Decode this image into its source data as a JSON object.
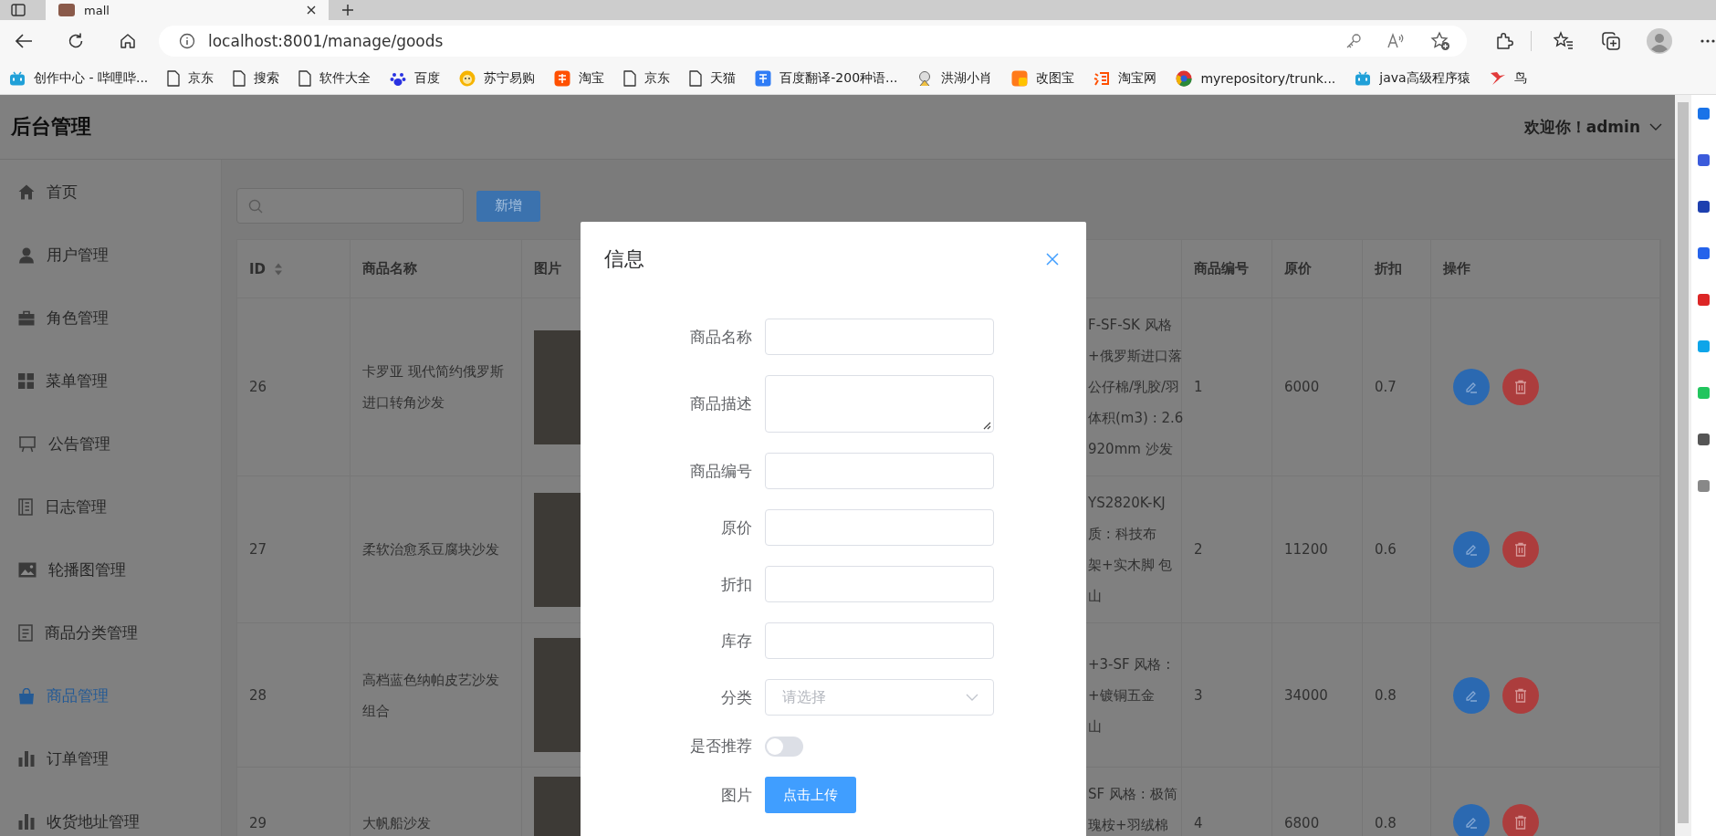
{
  "browser": {
    "tab_title": "mall",
    "url": "localhost:8001/manage/goods",
    "bookmarks": [
      {
        "label": "创作中心 - 哔哩哔...",
        "kind": "tv"
      },
      {
        "label": "京东",
        "kind": "page"
      },
      {
        "label": "搜索",
        "kind": "page"
      },
      {
        "label": "软件大全",
        "kind": "page"
      },
      {
        "label": "百度",
        "kind": "paw"
      },
      {
        "label": "苏宁易购",
        "kind": "lion"
      },
      {
        "label": "淘宝",
        "kind": "orange-square"
      },
      {
        "label": "京东",
        "kind": "page"
      },
      {
        "label": "天猫",
        "kind": "page"
      },
      {
        "label": "百度翻译-200种语...",
        "kind": "blue-square"
      },
      {
        "label": "洪湖小肖",
        "kind": "figure"
      },
      {
        "label": "改图宝",
        "kind": "yellow-square"
      },
      {
        "label": "淘宝网",
        "kind": "orange-mark"
      },
      {
        "label": "myrepository/trunk...",
        "kind": "circle"
      },
      {
        "label": "java高级程序猿",
        "kind": "tv"
      },
      {
        "label": "鸟",
        "kind": "bird"
      }
    ]
  },
  "app": {
    "title": "后台管理",
    "user": "欢迎你！admin"
  },
  "sidebar": {
    "items": [
      {
        "label": "首页",
        "kind": "home",
        "selected": false
      },
      {
        "label": "用户管理",
        "kind": "user",
        "selected": false
      },
      {
        "label": "角色管理",
        "kind": "briefcase",
        "selected": false
      },
      {
        "label": "菜单管理",
        "kind": "grid",
        "selected": false
      },
      {
        "label": "公告管理",
        "kind": "board",
        "selected": false
      },
      {
        "label": "日志管理",
        "kind": "notebook",
        "selected": false
      },
      {
        "label": "轮播图管理",
        "kind": "image",
        "selected": false
      },
      {
        "label": "商品分类管理",
        "kind": "document",
        "selected": false
      },
      {
        "label": "商品管理",
        "kind": "bag",
        "selected": true
      },
      {
        "label": "订单管理",
        "kind": "chart",
        "selected": false
      },
      {
        "label": "收货地址管理",
        "kind": "chart",
        "selected": false
      }
    ]
  },
  "toolbar": {
    "add_button": "新增"
  },
  "table": {
    "columns": [
      {
        "label": "ID",
        "sortable": true
      },
      {
        "label": "商品名称"
      },
      {
        "label": "图片"
      },
      {
        "label": "商品编号"
      },
      {
        "label": "原价"
      },
      {
        "label": "折扣"
      },
      {
        "label": "操作"
      }
    ],
    "rows": [
      {
        "id": "26",
        "name": "卡罗亚 现代简约俄罗斯进口转角沙发",
        "description": [
          "F-SF-SK 风格",
          "+俄罗斯进口落",
          "公仔棉/乳胶/羽",
          "体积(m3) : 2.6",
          "920mm 沙发"
        ],
        "code": "1",
        "price": "6000",
        "discount": "0.7"
      },
      {
        "id": "27",
        "name": "柔软治愈系豆腐块沙发",
        "description": [
          "YS2820K-KJ",
          "质 : 科技布",
          "架+实木脚 包",
          "山"
        ],
        "code": "2",
        "price": "11200",
        "discount": "0.6"
      },
      {
        "id": "28",
        "name": "高档蓝色纳帕皮艺沙发组合",
        "description": [
          "+3-SF 风格 :",
          "+镀铜五金",
          "山"
        ],
        "code": "3",
        "price": "34000",
        "discount": "0.8"
      },
      {
        "id": "29",
        "name": "大帆船沙发",
        "description": [
          "SF 风格 : 极简",
          "瑰桉+羽绒棉"
        ],
        "code": "4",
        "price": "6800",
        "discount": "0.8"
      }
    ]
  },
  "dialog": {
    "title": "信息",
    "fields": [
      {
        "label": "商品名称",
        "kind": "input"
      },
      {
        "label": "商品描述",
        "kind": "textarea"
      },
      {
        "label": "商品编号",
        "kind": "input"
      },
      {
        "label": "原价",
        "kind": "input"
      },
      {
        "label": "折扣",
        "kind": "input"
      },
      {
        "label": "库存",
        "kind": "input"
      },
      {
        "label": "分类",
        "kind": "select",
        "placeholder": "请选择"
      },
      {
        "label": "是否推荐",
        "kind": "switch",
        "on": false
      },
      {
        "label": "图片",
        "kind": "upload",
        "button": "点击上传"
      }
    ]
  }
}
